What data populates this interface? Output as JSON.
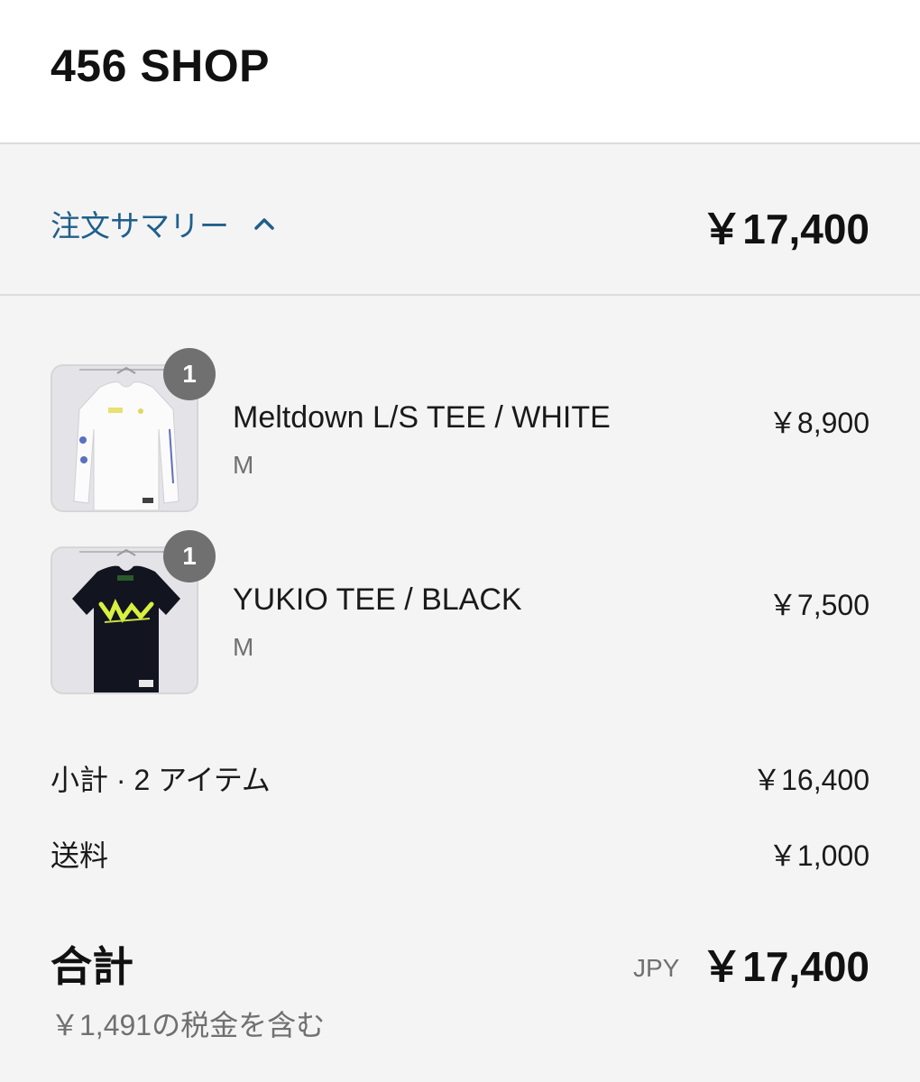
{
  "header": {
    "shop_name": "456 SHOP"
  },
  "summary": {
    "toggle_label": "注文サマリー",
    "total": "￥17,400"
  },
  "items": [
    {
      "quantity": "1",
      "title": "Meltdown L/S TEE / WHITE",
      "variant": "M",
      "price": "￥8,900",
      "image": "white-longsleeve-tee"
    },
    {
      "quantity": "1",
      "title": "YUKIO TEE / BLACK",
      "variant": "M",
      "price": "￥7,500",
      "image": "black-tee"
    }
  ],
  "subtotal": {
    "label": "小計 · 2 アイテム",
    "value": "￥16,400"
  },
  "shipping": {
    "label": "送料",
    "value": "￥1,000"
  },
  "total": {
    "label": "合計",
    "currency": "JPY",
    "value": "￥17,400",
    "tax_note": "￥1,491の税金を含む"
  },
  "colors": {
    "link": "#1f5f8b",
    "badge": "#707070",
    "background": "#f4f4f4"
  }
}
